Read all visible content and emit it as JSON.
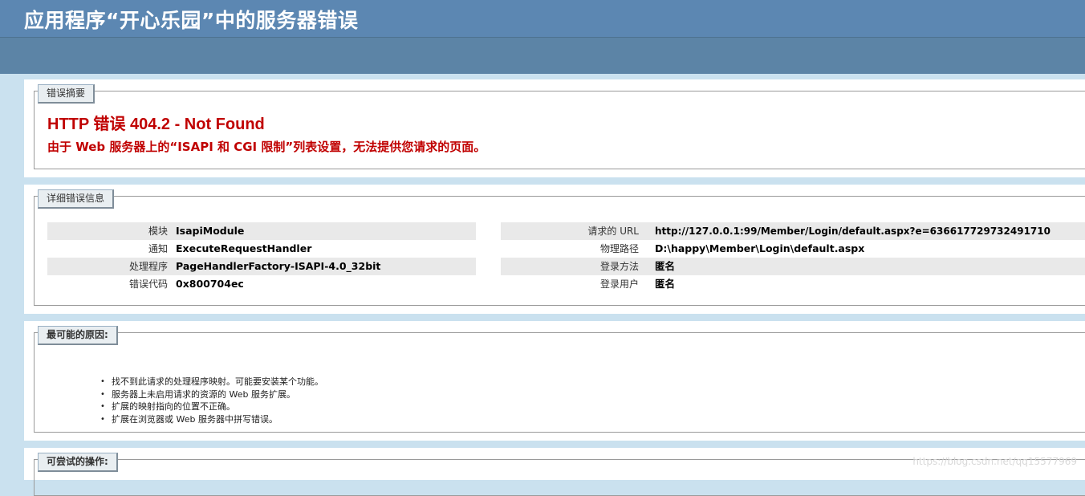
{
  "header": {
    "title": "应用程序“开心乐园”中的服务器错误"
  },
  "summary": {
    "legend": "错误摘要",
    "title": "HTTP 错误 404.2 - Not Found",
    "description": "由于 Web 服务器上的“ISAPI 和 CGI 限制”列表设置，无法提供您请求的页面。"
  },
  "details": {
    "legend": "详细错误信息",
    "left": [
      {
        "label": "模块",
        "value": "IsapiModule"
      },
      {
        "label": "通知",
        "value": "ExecuteRequestHandler"
      },
      {
        "label": "处理程序",
        "value": "PageHandlerFactory-ISAPI-4.0_32bit"
      },
      {
        "label": "错误代码",
        "value": "0x800704ec"
      }
    ],
    "right": [
      {
        "label": "请求的 URL",
        "value": "http://127.0.0.1:99/Member/Login/default.aspx?e=636617729732491710"
      },
      {
        "label": "物理路径",
        "value": "D:\\happy\\Member\\Login\\default.aspx"
      },
      {
        "label": "登录方法",
        "value": "匿名"
      },
      {
        "label": "登录用户",
        "value": "匿名"
      }
    ]
  },
  "causes": {
    "legend": "最可能的原因:",
    "bullet": "•",
    "items": [
      "找不到此请求的处理程序映射。可能要安装某个功能。",
      "服务器上未启用请求的资源的 Web 服务扩展。",
      "扩展的映射指向的位置不正确。",
      "扩展在浏览器或 Web 服务器中拼写错误。"
    ]
  },
  "actions": {
    "legend": "可尝试的操作:"
  },
  "watermark": "https://blog.csdn.net/qq15577969"
}
